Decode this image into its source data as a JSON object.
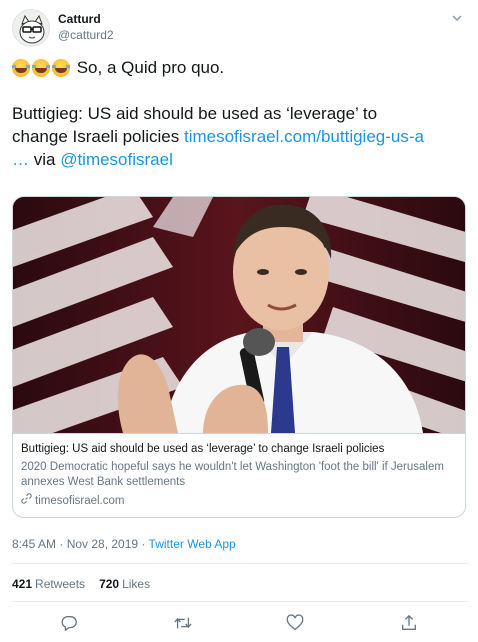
{
  "user": {
    "display_name": "Catturd",
    "handle": "@catturd2"
  },
  "tweet": {
    "line1_emojis": [
      "face-with-tears-of-joy",
      "face-with-tears-of-joy",
      "face-with-tears-of-joy"
    ],
    "line1_text": " So, a Quid pro quo.",
    "line2_text": "Buttigieg: US aid should be used as ‘leverage’ to",
    "line3_text": "change Israeli policies ",
    "line3_link": "timesofisrael.com/buttigieg-us-a",
    "line4_link": "…",
    "line4_via": " via ",
    "line4_mention": "@timesofisrael"
  },
  "card": {
    "title": "Buttigieg: US aid should be used as ‘leverage’ to change Israeli policies",
    "description": "2020 Democratic hopeful says he wouldn't let Washington 'foot the bill' if Jerusalem annexes West Bank settlements",
    "domain": "timesofisrael.com"
  },
  "meta": {
    "time_date": "8:45 AM · Nov 28, 2019 · ",
    "app": "Twitter Web App"
  },
  "stats": {
    "retweets_count": "421",
    "retweets_label": "Retweets",
    "likes_count": "720",
    "likes_label": "Likes"
  },
  "colors": {
    "link": "#1b95e0",
    "text": "#14171a",
    "muted": "#657786",
    "border": "#ccd6dd"
  },
  "icons": {
    "menu": "chevron-down-icon",
    "reply": "reply-icon",
    "retweet": "retweet-icon",
    "like": "heart-icon",
    "share": "share-icon",
    "card_domain": "link-icon"
  }
}
